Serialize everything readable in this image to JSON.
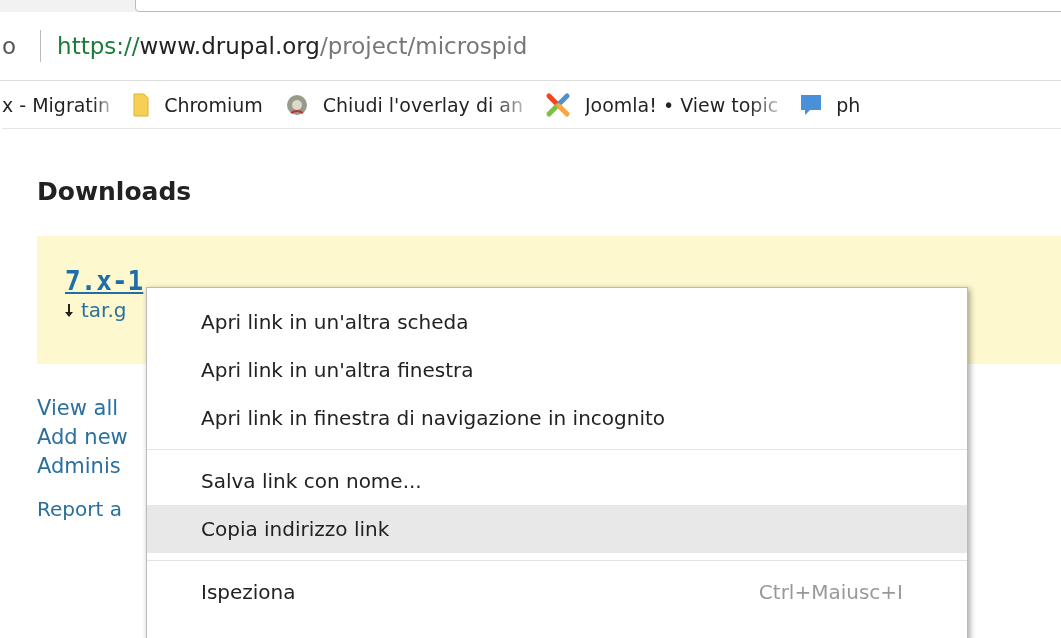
{
  "address_bar": {
    "left_fragment": "o",
    "url_scheme": "https://",
    "url_host": "www.drupal.org",
    "url_path": "/project/microspid"
  },
  "bookmarks": [
    {
      "label": "x - Migratin"
    },
    {
      "label": "Chromium"
    },
    {
      "label": "Chiudi l'overlay di an"
    },
    {
      "label": "Joomla! • View topic"
    },
    {
      "label": "ph"
    }
  ],
  "page": {
    "heading": "Downloads",
    "release": {
      "version": "7.x-1",
      "file": "tar.g"
    },
    "links": [
      "View all",
      "Add new",
      "Adminis"
    ],
    "report": "Report a"
  },
  "context_menu": {
    "sections": [
      {
        "items": [
          {
            "label": "Apri link in un'altra scheda",
            "selected": false
          },
          {
            "label": "Apri link in un'altra finestra",
            "selected": false
          },
          {
            "label": "Apri link in finestra di navigazione in incognito",
            "selected": false
          }
        ]
      },
      {
        "items": [
          {
            "label": "Salva link con nome...",
            "selected": false
          },
          {
            "label": "Copia indirizzo link",
            "selected": true
          }
        ]
      },
      {
        "items": [
          {
            "label": "Ispeziona",
            "shortcut": "Ctrl+Maiusc+I",
            "selected": false
          }
        ]
      }
    ]
  }
}
